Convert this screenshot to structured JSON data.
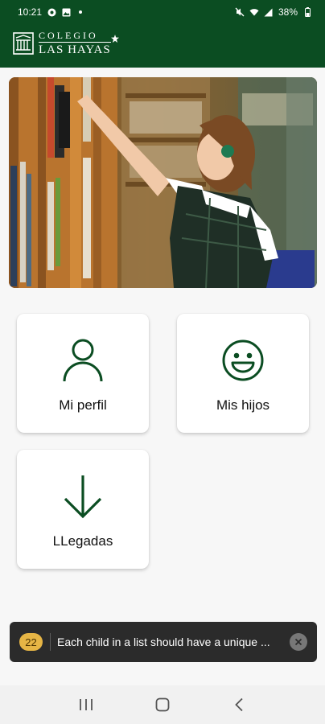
{
  "status_bar": {
    "time": "10:21",
    "battery": "38%",
    "icons": [
      "app-notification-icon",
      "gallery-icon",
      "dot-icon",
      "mute-icon",
      "wifi-icon",
      "signal-icon",
      "battery-icon"
    ]
  },
  "app_bar": {
    "logo_line1": "COLEGIO",
    "logo_line2": "LAS HAYAS",
    "background": "#0b4d22"
  },
  "hero": {
    "icon": "hero-photo"
  },
  "menu": {
    "cards": [
      {
        "label": "Mi perfil",
        "icon": "person-icon"
      },
      {
        "label": "Mis hijos",
        "icon": "smiley-icon"
      },
      {
        "label": "LLegadas",
        "icon": "arrow-down-icon"
      }
    ],
    "accent": "#0b4d22"
  },
  "toast": {
    "count": "22",
    "message": "Each child in a list should have a unique ...",
    "count_color": "#e6b545"
  },
  "nav": {
    "icons": [
      "recents-icon",
      "home-icon",
      "back-icon"
    ]
  }
}
